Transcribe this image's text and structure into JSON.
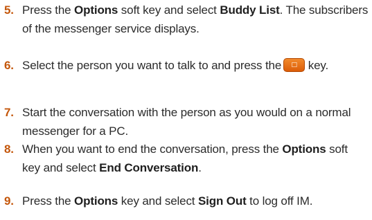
{
  "steps": [
    {
      "number": "5.",
      "t1": "Press the ",
      "b1": "Options",
      "t2": " soft key and select ",
      "b2": "Buddy List",
      "t3": ". The subscribers of the messenger service displays."
    },
    {
      "number": "6.",
      "t1": "Select the person you want to talk to and press the",
      "icon": "send-key-icon",
      "t2": " key."
    },
    {
      "number": "7.",
      "t1": "Start the conversation with the person as you would on a normal messenger for a PC."
    },
    {
      "number": "8.",
      "t1": "When you want to end the conversation, press the ",
      "b1": "Options",
      "t2": " soft key and select ",
      "b2": "End Conversation",
      "t3": "."
    },
    {
      "number": "9.",
      "t1": "Press the ",
      "b1": "Options",
      "t2": " key and select ",
      "b2": "Sign Out",
      "t3": " to log off IM."
    }
  ],
  "colors": {
    "step_number": "#c4570b",
    "body_text": "#2b2b2b",
    "send_key": "#e8700f"
  }
}
